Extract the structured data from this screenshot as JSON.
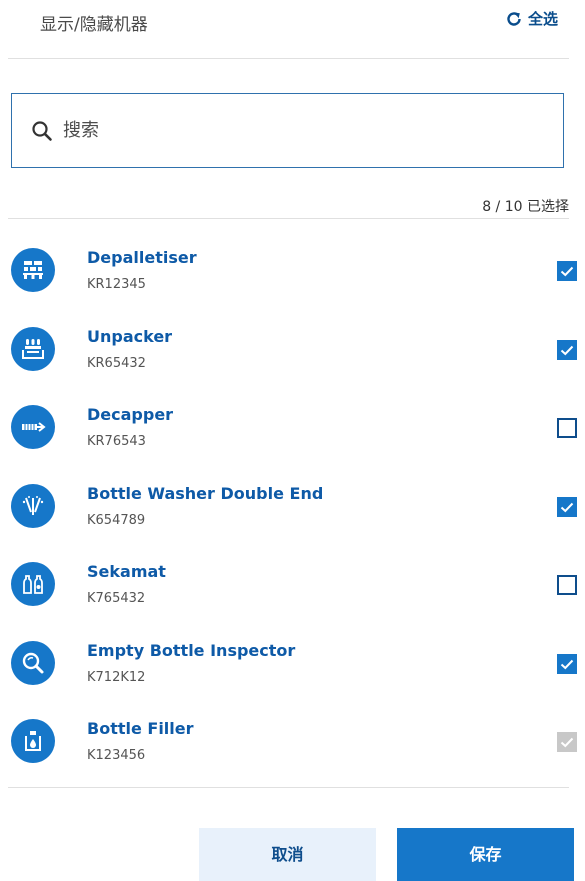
{
  "header": {
    "title": "显示/隐藏机器",
    "select_all_label": "全选",
    "select_all_icon": "refresh-icon"
  },
  "search": {
    "placeholder": "搜索",
    "value": "",
    "icon": "search-icon"
  },
  "selection_count": "8 / 10 已选择",
  "colors": {
    "accent": "#1677c9",
    "title_blue": "#0e5aa7",
    "checkbox_border": "#0e4d8c",
    "disabled": "#c8c8c8"
  },
  "machines": [
    {
      "name": "Depalletiser",
      "code": "KR12345",
      "icon": "depalletiser-icon",
      "checked": true,
      "disabled": false
    },
    {
      "name": "Unpacker",
      "code": "KR65432",
      "icon": "unpacker-icon",
      "checked": true,
      "disabled": false
    },
    {
      "name": "Decapper",
      "code": "KR76543",
      "icon": "decapper-icon",
      "checked": false,
      "disabled": false
    },
    {
      "name": "Bottle Washer Double End",
      "code": "K654789",
      "icon": "bottle-washer-icon",
      "checked": true,
      "disabled": false
    },
    {
      "name": "Sekamat",
      "code": "K765432",
      "icon": "sekamat-icon",
      "checked": false,
      "disabled": false
    },
    {
      "name": "Empty Bottle Inspector",
      "code": "K712K12",
      "icon": "inspector-icon",
      "checked": true,
      "disabled": false
    },
    {
      "name": "Bottle Filler",
      "code": "K123456",
      "icon": "bottle-filler-icon",
      "checked": true,
      "disabled": true
    }
  ],
  "footer": {
    "cancel_label": "取消",
    "save_label": "保存"
  }
}
